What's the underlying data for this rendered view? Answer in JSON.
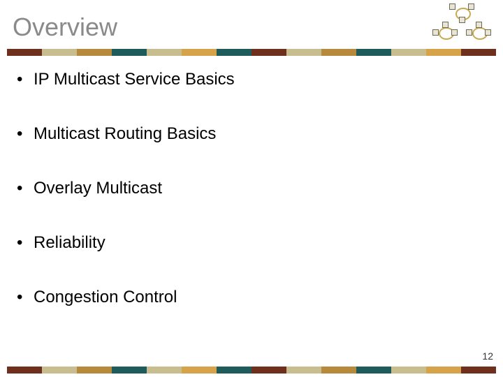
{
  "title": "Overview",
  "bullets": [
    "IP Multicast Service Basics",
    "Multicast Routing Basics",
    "Overlay Multicast",
    "Reliability",
    "Congestion Control"
  ],
  "page_number": "12",
  "bar_colors": [
    "#6f2f1d",
    "#c7bd8f",
    "#b6893c",
    "#1e5b5b",
    "#c7bd8f",
    "#d6a34a",
    "#1e5b5b",
    "#6f2f1d",
    "#c7bd8f",
    "#b6893c",
    "#1e5b5b",
    "#c7bd8f",
    "#d6a34a",
    "#6f2f1d"
  ]
}
